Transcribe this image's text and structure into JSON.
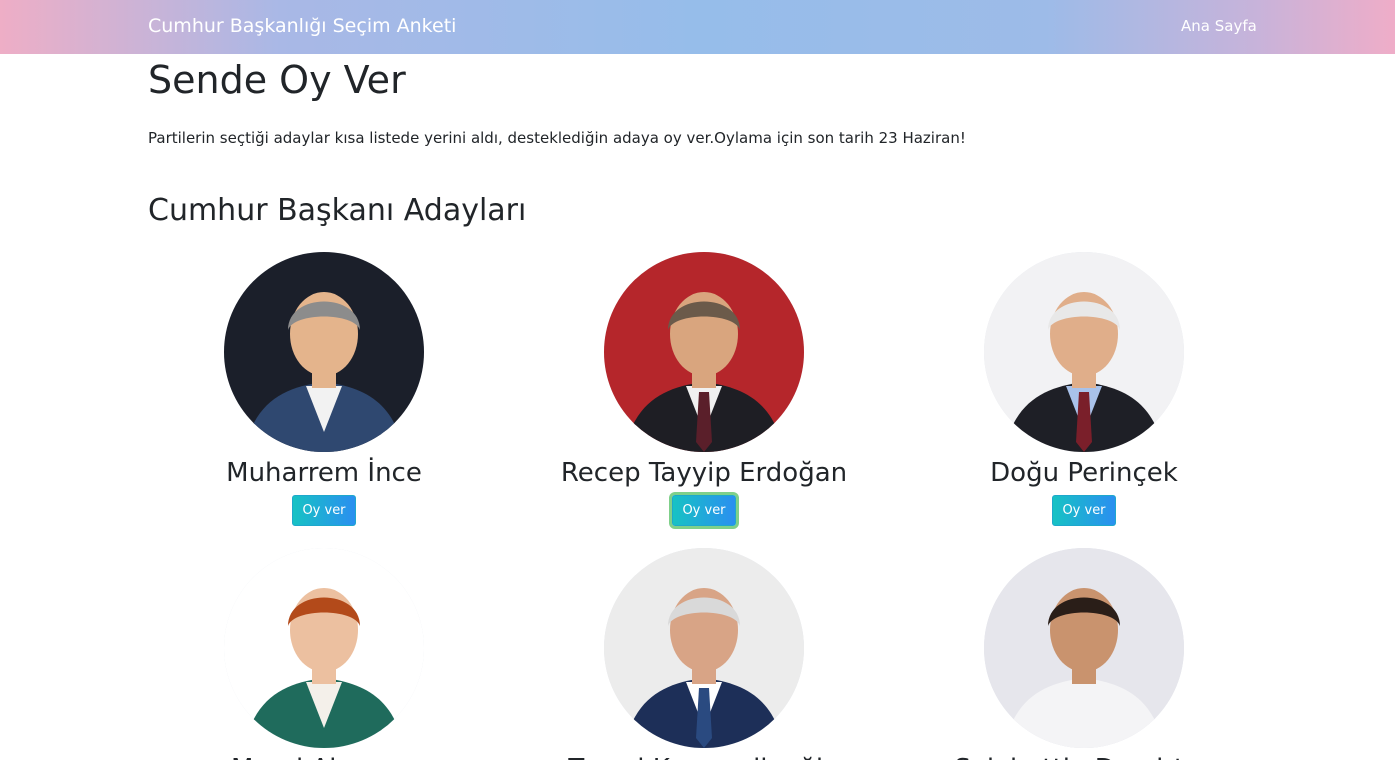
{
  "navbar": {
    "brand": "Cumhur Başkanlığı Seçim Anketi",
    "home_link": "Ana Sayfa"
  },
  "page": {
    "title": "Sende Oy Ver",
    "intro": "Partilerin seçtiği adaylar kısa listede yerini aldı, desteklediğin adaya oy ver.Oylama için son tarih 23 Haziran!",
    "section_title": "Cumhur Başkanı Adayları"
  },
  "vote_label": "Oy ver",
  "candidates": [
    {
      "name": "Muharrem İnce",
      "bg": "#1b1f2a",
      "suit": "#2f4870",
      "shirt": "#f2f2f2",
      "tie": "none",
      "hair": "#8c8c8c",
      "skin": "#e4b48c"
    },
    {
      "name": "Recep Tayyip Erdoğan",
      "bg": "#b5262b",
      "suit": "#1e1e24",
      "shirt": "#f0f0f0",
      "tie": "#5a1f2a",
      "hair": "#6b5a4a",
      "skin": "#d9a57e"
    },
    {
      "name": "Doğu Perinçek",
      "bg": "#f2f2f4",
      "suit": "#1e1f26",
      "shirt": "#a9c2ea",
      "tie": "#7a1f2a",
      "hair": "#e8e8e8",
      "skin": "#e0ae8a"
    },
    {
      "name": "Meral Akşener",
      "bg": "#ffffff",
      "suit": "#1f6b5c",
      "shirt": "#f4f0ea",
      "tie": "none",
      "hair": "#b34a1a",
      "skin": "#ecc0a0"
    },
    {
      "name": "Temel Karamollaoğlu",
      "bg": "#ececec",
      "suit": "#1d2f58",
      "shirt": "#ffffff",
      "tie": "#2a4a80",
      "hair": "#d9d9d9",
      "skin": "#d8a486"
    },
    {
      "name": "Selahattin Demirtaş",
      "bg": "#e6e6ec",
      "suit": "#f4f4f6",
      "shirt": "#f4f4f6",
      "tie": "none",
      "hair": "#2a1e18",
      "skin": "#c9936e"
    }
  ]
}
